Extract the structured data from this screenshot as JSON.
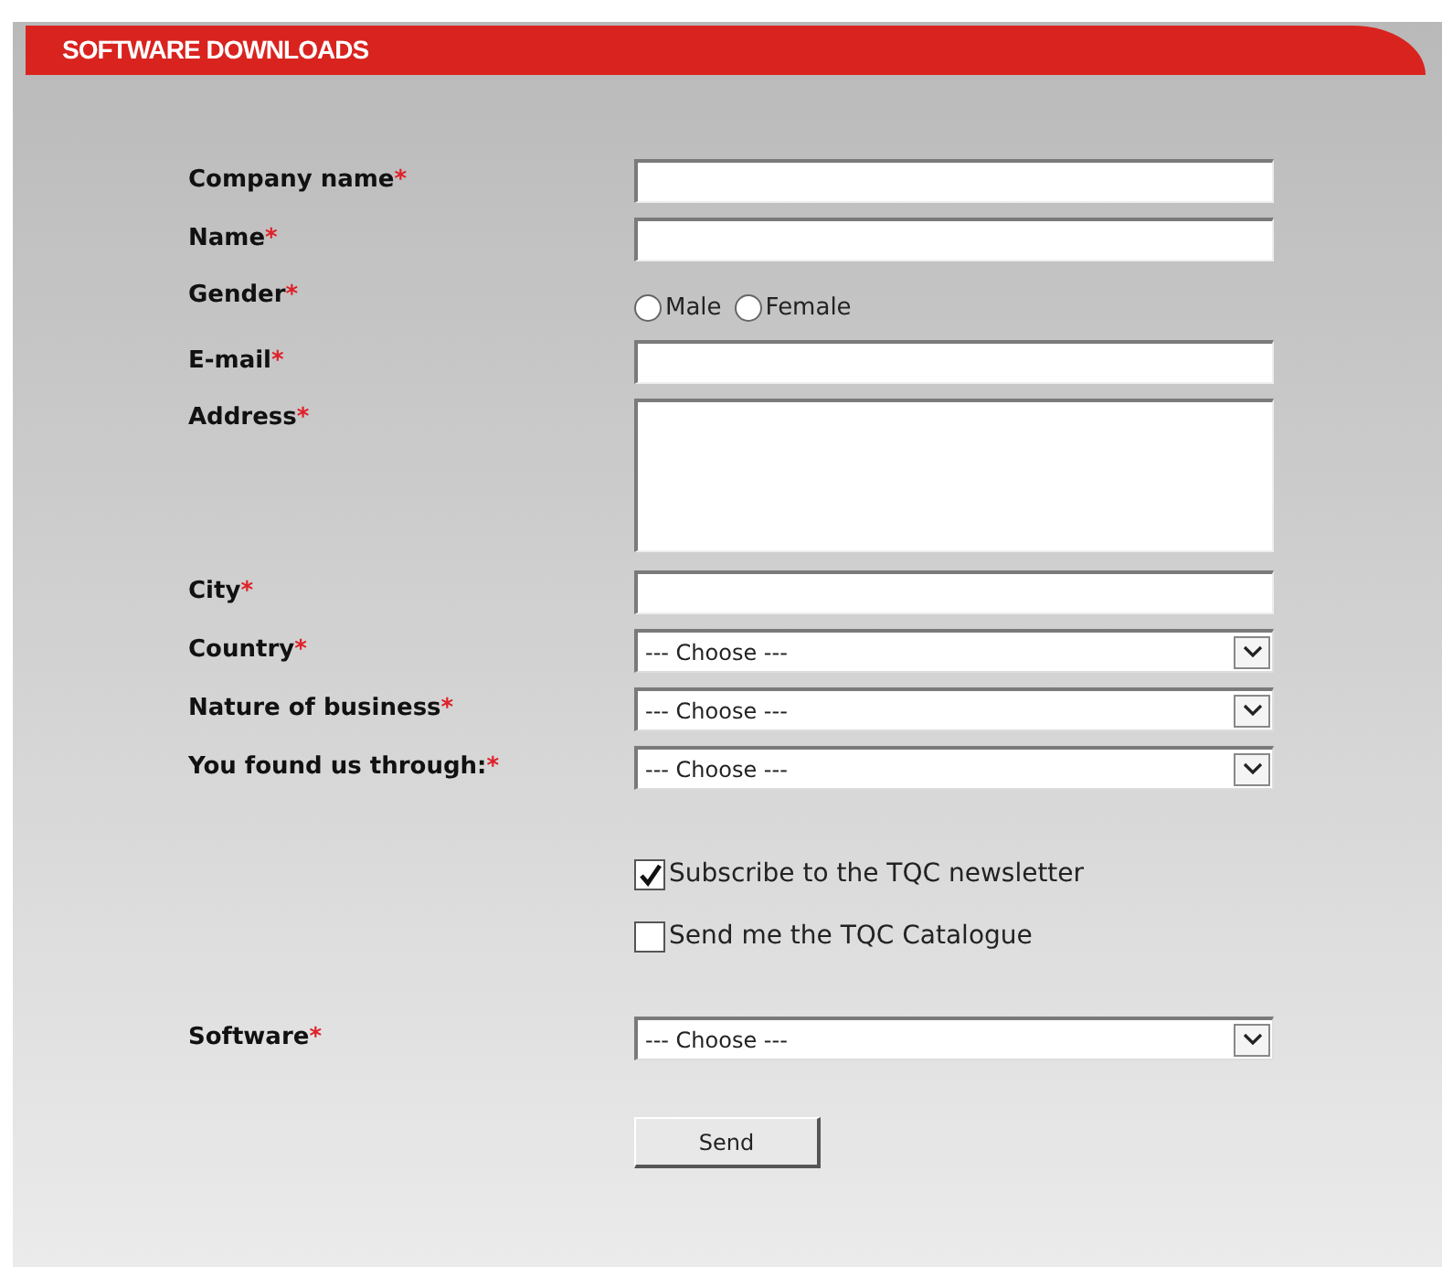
{
  "header": {
    "title": "SOFTWARE DOWNLOADS"
  },
  "fields": [
    {
      "kind": "text",
      "label": "Company name",
      "required_mark": "*"
    },
    {
      "kind": "text",
      "label": "Name",
      "required_mark": "*"
    },
    {
      "kind": "radio",
      "label": "Gender",
      "required_mark": "*",
      "options": [
        {
          "label": "Male",
          "selected": false
        },
        {
          "label": "Female",
          "selected": false
        }
      ]
    },
    {
      "kind": "text",
      "label": "E-mail",
      "required_mark": "*"
    },
    {
      "kind": "textarea",
      "label": "Address",
      "required_mark": "*"
    },
    {
      "kind": "text",
      "label": "City",
      "required_mark": "*"
    },
    {
      "kind": "select",
      "label": "Country",
      "required_mark": "*",
      "value": "--- Choose ---"
    },
    {
      "kind": "select",
      "label": "Nature of business",
      "required_mark": "*",
      "value": "--- Choose ---"
    },
    {
      "kind": "select",
      "label": "You found us through:",
      "required_mark": "*",
      "value": "--- Choose ---"
    }
  ],
  "checkboxes": [
    {
      "label": "Subscribe to the TQC newsletter",
      "checked": true
    },
    {
      "label": "Send me the TQC Catalogue",
      "checked": false
    }
  ],
  "software": {
    "kind": "select",
    "label": "Software",
    "required_mark": "*",
    "value": "--- Choose ---"
  },
  "send_button": "Send"
}
